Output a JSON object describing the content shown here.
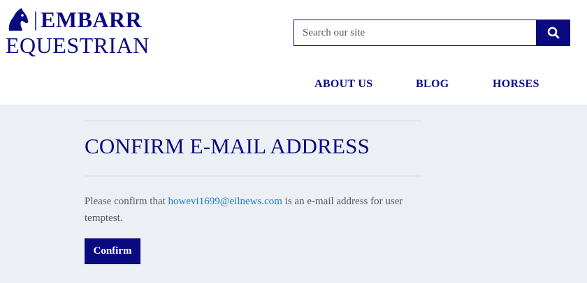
{
  "brand": {
    "separator": "|",
    "line1": "EMBARR",
    "line2": "EQUESTRIAN",
    "icon": "horse-head-icon",
    "color": "#0a0a80"
  },
  "search": {
    "placeholder": "Search our site",
    "value": "",
    "button_icon": "search-icon"
  },
  "nav": {
    "items": [
      {
        "label": "ABOUT US"
      },
      {
        "label": "BLOG"
      },
      {
        "label": "HORSES"
      }
    ]
  },
  "main": {
    "title": "CONFIRM E-MAIL ADDRESS",
    "message_before": "Please confirm that ",
    "email": "howevi1699@eilnews.com",
    "message_after": " is an e-mail address for user temptest.",
    "confirm_label": "Confirm"
  },
  "colors": {
    "brand": "#0a0a80",
    "background": "#eceff4",
    "link": "#1a7fc8",
    "body_text": "#555a63"
  }
}
